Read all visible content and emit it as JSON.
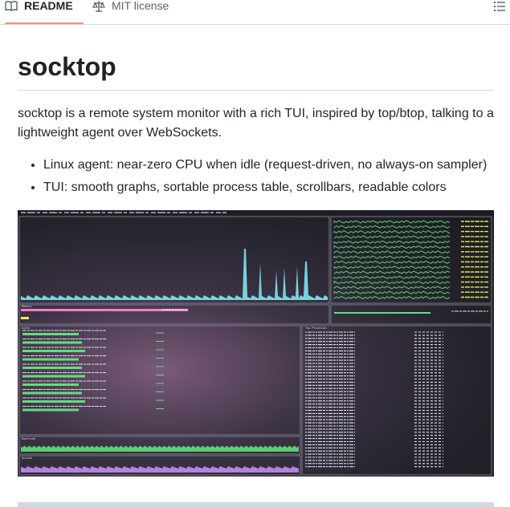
{
  "tabs": {
    "readme_label": "README",
    "license_label": "MIT license"
  },
  "heading": "socktop",
  "intro": "socktop is a remote system monitor with a rich TUI, inspired by top/btop, talking to a lightweight agent over WebSockets.",
  "features": [
    "Linux agent: near-zero CPU when idle (request-driven, no always-on sampler)",
    "TUI: smooth graphs, sortable process table, scrollbars, readable colors"
  ],
  "screenshot": {
    "panel_labels": {
      "memory": "Memory",
      "disks": "Disks",
      "download": "Download",
      "upload": "Upload",
      "processes": "Top Processes"
    },
    "colors": {
      "cpu_graph": "#7fe6f0",
      "memory_bar": "#ff7fc8",
      "swap_bar": "#f3e36a",
      "disk_bar": "#5fe07a",
      "download_graph": "#5fe07a",
      "upload_graph": "#c08cf0",
      "core_text": "#e8e85a"
    }
  }
}
